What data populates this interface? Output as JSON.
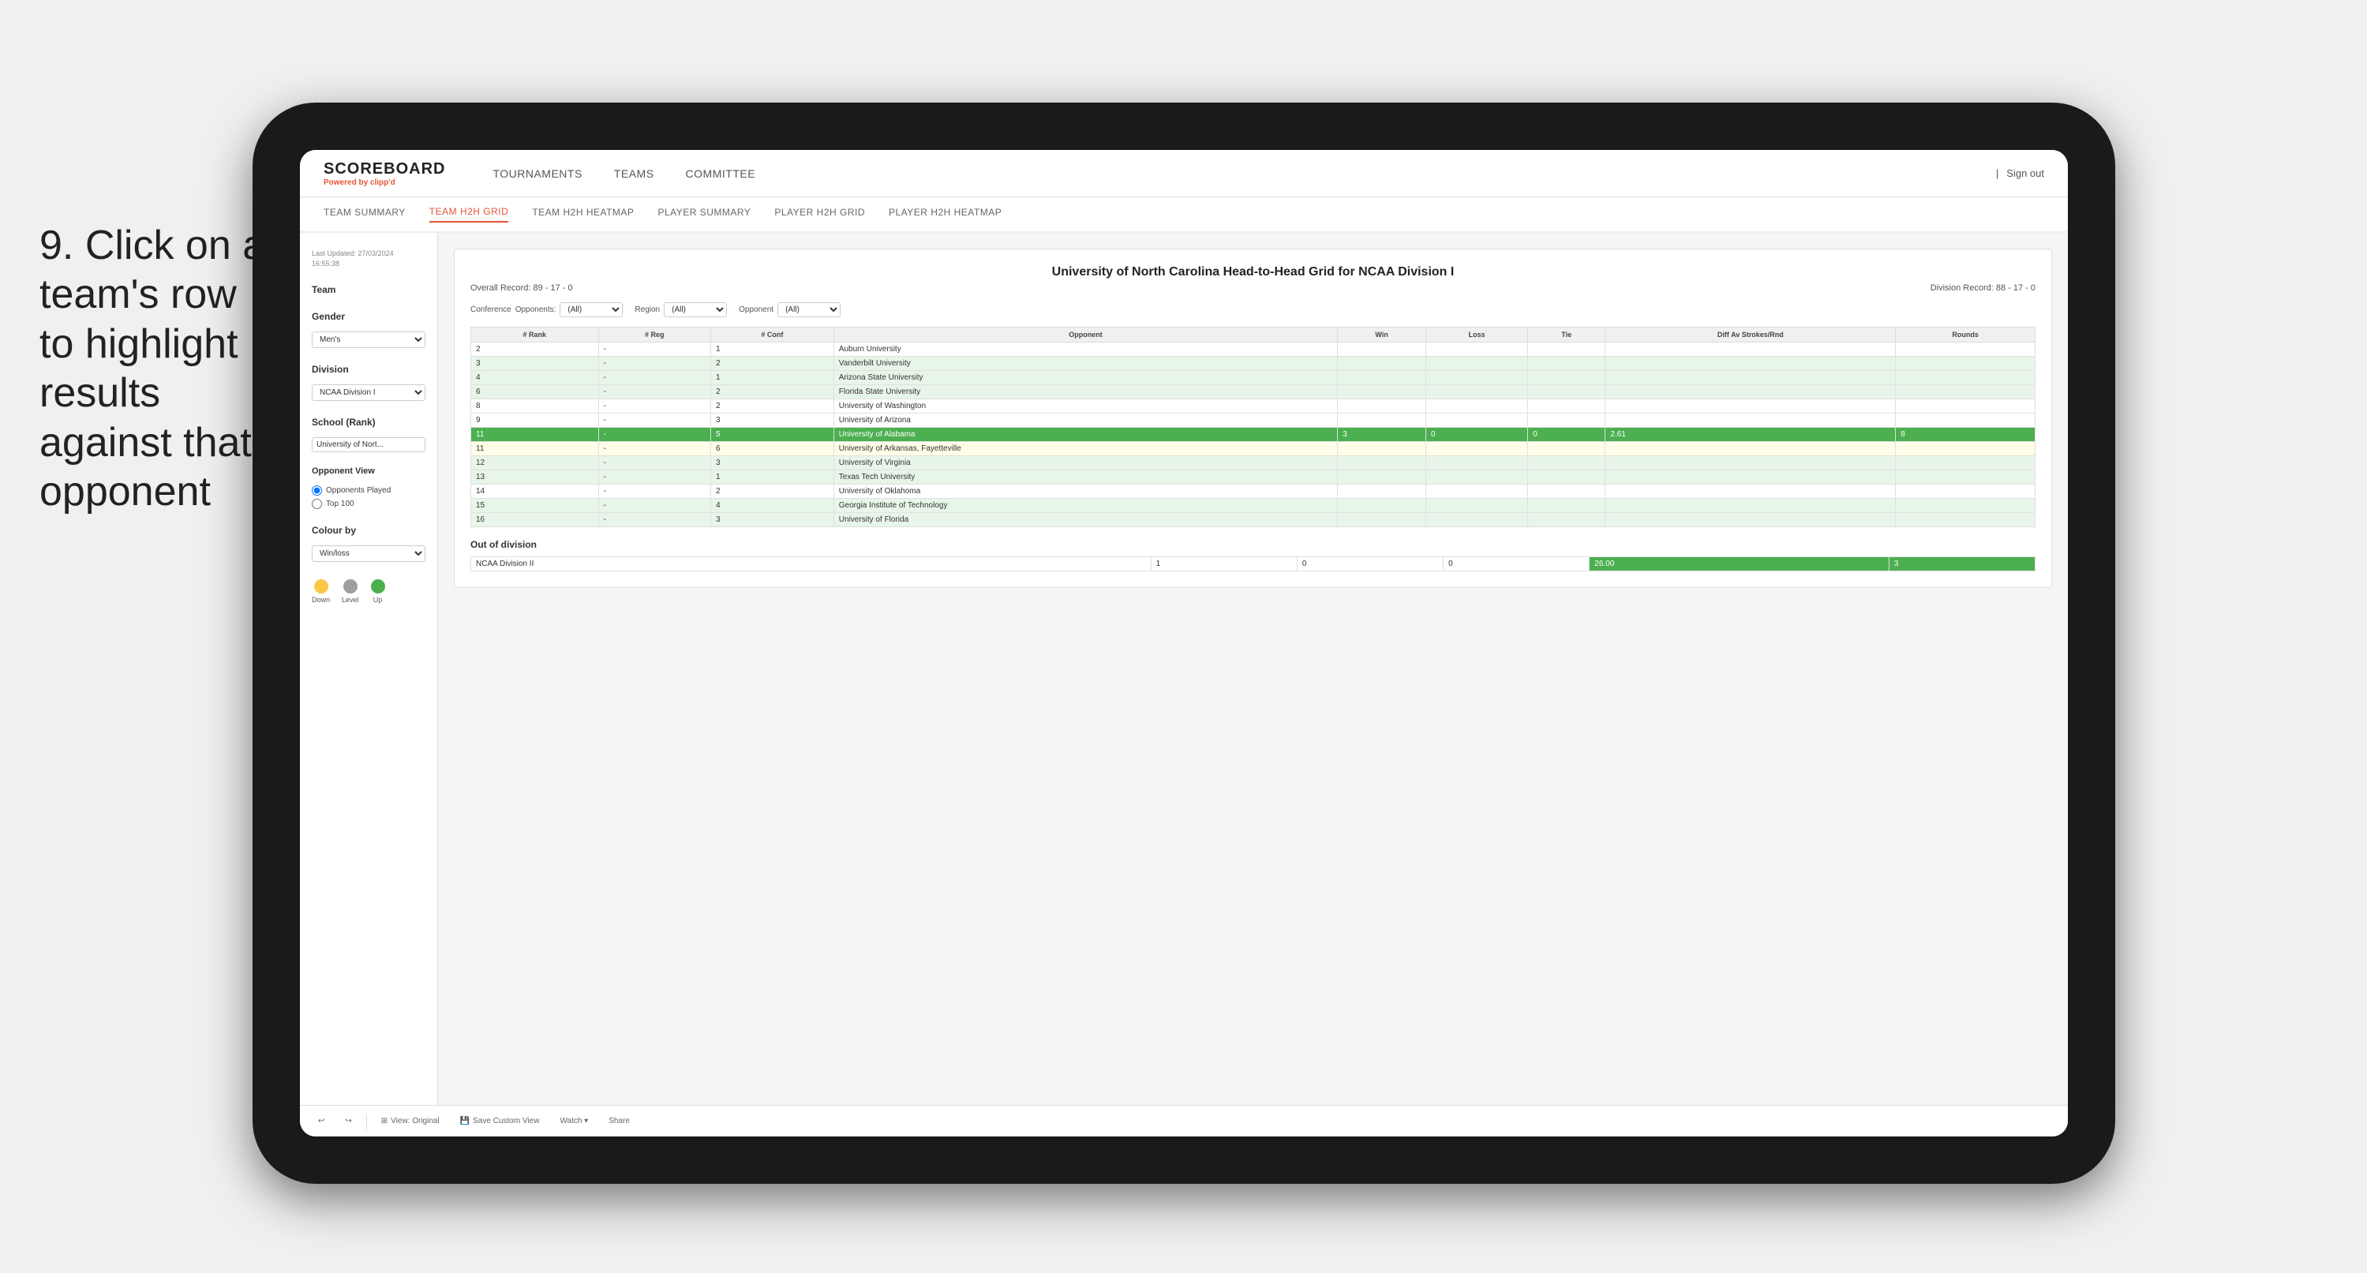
{
  "instruction": {
    "step": "9.",
    "text": "Click on a team's row to highlight results against that opponent"
  },
  "tablet": {
    "topNav": {
      "logo": "SCOREBOARD",
      "poweredBy": "Powered by",
      "brand": "clipp'd",
      "links": [
        "TOURNAMENTS",
        "TEAMS",
        "COMMITTEE"
      ],
      "signOut": "Sign out"
    },
    "subNav": {
      "links": [
        "TEAM SUMMARY",
        "TEAM H2H GRID",
        "TEAM H2H HEATMAP",
        "PLAYER SUMMARY",
        "PLAYER H2H GRID",
        "PLAYER H2H HEATMAP"
      ],
      "active": "TEAM H2H GRID"
    },
    "sidebar": {
      "lastUpdated": "Last Updated: 27/03/2024",
      "time": "16:55:38",
      "teamLabel": "Team",
      "genderLabel": "Gender",
      "genderValue": "Men's",
      "divisionLabel": "Division",
      "divisionValue": "NCAA Division I",
      "schoolLabel": "School (Rank)",
      "schoolValue": "University of Nort...",
      "opponentViewLabel": "Opponent View",
      "opponentOptions": [
        "Opponents Played",
        "Top 100"
      ],
      "colourByLabel": "Colour by",
      "colourByValue": "Win/loss",
      "legend": [
        {
          "label": "Down",
          "color": "#f9c846"
        },
        {
          "label": "Level",
          "color": "#9e9e9e"
        },
        {
          "label": "Up",
          "color": "#4caf50"
        }
      ]
    },
    "mainPanel": {
      "title": "University of North Carolina Head-to-Head Grid for NCAA Division I",
      "overallRecord": "Overall Record: 89 - 17 - 0",
      "divisionRecord": "Division Record: 88 - 17 - 0",
      "filters": {
        "conferencePlaceholder": "(All)",
        "regionPlaceholder": "(All)",
        "opponentPlaceholder": "(All)"
      },
      "tableHeaders": [
        "# Rank",
        "# Reg",
        "# Conf",
        "Opponent",
        "Win",
        "Loss",
        "Tie",
        "Diff Av Strokes/Rnd",
        "Rounds"
      ],
      "rows": [
        {
          "rank": "2",
          "reg": "-",
          "conf": "1",
          "opponent": "Auburn University",
          "win": "",
          "loss": "",
          "tie": "",
          "diff": "",
          "rounds": "",
          "style": "normal"
        },
        {
          "rank": "3",
          "reg": "-",
          "conf": "2",
          "opponent": "Vanderbilt University",
          "win": "",
          "loss": "",
          "tie": "",
          "diff": "",
          "rounds": "",
          "style": "light-green"
        },
        {
          "rank": "4",
          "reg": "-",
          "conf": "1",
          "opponent": "Arizona State University",
          "win": "",
          "loss": "",
          "tie": "",
          "diff": "",
          "rounds": "",
          "style": "light-green"
        },
        {
          "rank": "6",
          "reg": "-",
          "conf": "2",
          "opponent": "Florida State University",
          "win": "",
          "loss": "",
          "tie": "",
          "diff": "",
          "rounds": "",
          "style": "light-green"
        },
        {
          "rank": "8",
          "reg": "-",
          "conf": "2",
          "opponent": "University of Washington",
          "win": "",
          "loss": "",
          "tie": "",
          "diff": "",
          "rounds": "",
          "style": "normal"
        },
        {
          "rank": "9",
          "reg": "-",
          "conf": "3",
          "opponent": "University of Arizona",
          "win": "",
          "loss": "",
          "tie": "",
          "diff": "",
          "rounds": "",
          "style": "normal"
        },
        {
          "rank": "11",
          "reg": "-",
          "conf": "5",
          "opponent": "University of Alabama",
          "win": "3",
          "loss": "0",
          "tie": "0",
          "diff": "2.61",
          "rounds": "8",
          "style": "highlighted"
        },
        {
          "rank": "11",
          "reg": "-",
          "conf": "6",
          "opponent": "University of Arkansas, Fayetteville",
          "win": "",
          "loss": "",
          "tie": "",
          "diff": "",
          "rounds": "",
          "style": "light-yellow"
        },
        {
          "rank": "12",
          "reg": "-",
          "conf": "3",
          "opponent": "University of Virginia",
          "win": "",
          "loss": "",
          "tie": "",
          "diff": "",
          "rounds": "",
          "style": "light-green"
        },
        {
          "rank": "13",
          "reg": "-",
          "conf": "1",
          "opponent": "Texas Tech University",
          "win": "",
          "loss": "",
          "tie": "",
          "diff": "",
          "rounds": "",
          "style": "light-green"
        },
        {
          "rank": "14",
          "reg": "-",
          "conf": "2",
          "opponent": "University of Oklahoma",
          "win": "",
          "loss": "",
          "tie": "",
          "diff": "",
          "rounds": "",
          "style": "normal"
        },
        {
          "rank": "15",
          "reg": "-",
          "conf": "4",
          "opponent": "Georgia Institute of Technology",
          "win": "",
          "loss": "",
          "tie": "",
          "diff": "",
          "rounds": "",
          "style": "light-green"
        },
        {
          "rank": "16",
          "reg": "-",
          "conf": "3",
          "opponent": "University of Florida",
          "win": "",
          "loss": "",
          "tie": "",
          "diff": "",
          "rounds": "",
          "style": "light-green"
        }
      ],
      "outOfDivision": {
        "label": "Out of division",
        "row": {
          "division": "NCAA Division II",
          "win": "1",
          "loss": "0",
          "tie": "0",
          "diff": "26.00",
          "rounds": "3"
        }
      }
    },
    "bottomToolbar": {
      "undoLabel": "↩",
      "redoLabel": "↪",
      "viewLabel": "View: Original",
      "saveLabel": "Save Custom View",
      "watchLabel": "Watch ▾",
      "shareLabel": "Share"
    }
  }
}
